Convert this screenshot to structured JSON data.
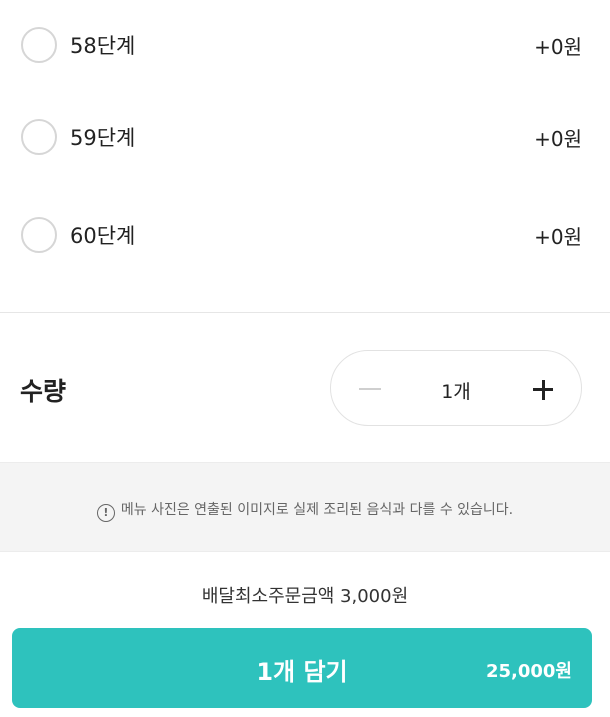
{
  "options": [
    {
      "label": "58단계",
      "price": "+0원"
    },
    {
      "label": "59단계",
      "price": "+0원"
    },
    {
      "label": "60단계",
      "price": "+0원"
    }
  ],
  "quantity": {
    "title": "수량",
    "value": "1개",
    "minus_icon": "minus-icon",
    "plus_icon": "plus-icon"
  },
  "notice": {
    "icon": "exclamation-circle-icon",
    "text": "메뉴 사진은 연출된 이미지로 실제 조리된 음식과 다를 수 있습니다."
  },
  "min_order": "배달최소주문금액 3,000원",
  "cta": {
    "label": "1개 담기",
    "price": "25,000원",
    "color": "#2ec2bd"
  }
}
